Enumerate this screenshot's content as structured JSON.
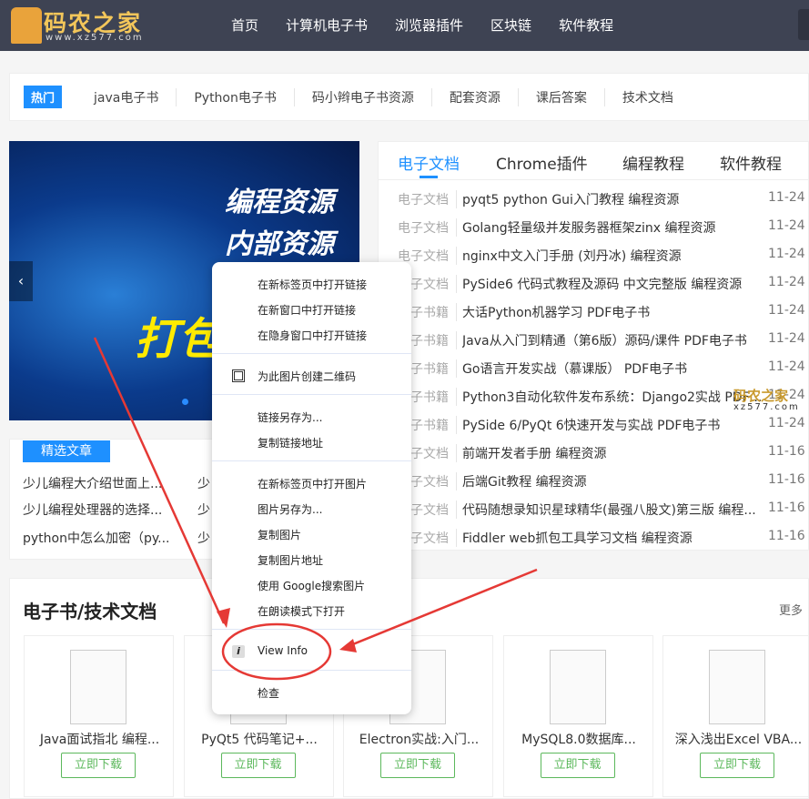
{
  "header": {
    "logo_text": "码农之家",
    "logo_url": "www.xz577.com",
    "nav": [
      "首页",
      "计算机电子书",
      "浏览器插件",
      "区块链",
      "软件教程"
    ]
  },
  "hot": {
    "tag": "热门",
    "links": [
      "java电子书",
      "Python电子书",
      "码小辫电子书资源",
      "配套资源",
      "课后答案",
      "技术文档"
    ]
  },
  "banner": {
    "line1": "编程资源",
    "line2": "内部资源",
    "line3": "打包",
    "prev_icon": "chevron-left-icon"
  },
  "featured": {
    "tag": "精选文章",
    "articles": [
      "少儿编程大介绍世面上...",
      "少儿编程处理器的选择...",
      "python中怎么加密（py...",
      "少",
      "少",
      "少"
    ]
  },
  "tabs": {
    "items": [
      "电子文档",
      "Chrome插件",
      "编程教程",
      "软件教程"
    ],
    "active": 0,
    "rows": [
      {
        "cat": "电子文档",
        "title": "pyqt5 python Gui入门教程 编程资源",
        "date": "11-24"
      },
      {
        "cat": "电子文档",
        "title": "Golang轻量级并发服务器框架zinx 编程资源",
        "date": "11-24"
      },
      {
        "cat": "电子文档",
        "title": "nginx中文入门手册 (刘丹冰) 编程资源",
        "date": "11-24"
      },
      {
        "cat": "电子文档",
        "title": "PySide6 代码式教程及源码 中文完整版 编程资源",
        "date": "11-24"
      },
      {
        "cat": "电子书籍",
        "title": "大话Python机器学习 PDF电子书",
        "date": "11-24"
      },
      {
        "cat": "电子书籍",
        "title": "Java从入门到精通（第6版）源码/课件 PDF电子书",
        "date": "11-24"
      },
      {
        "cat": "电子书籍",
        "title": "Go语言开发实战（慕课版） PDF电子书",
        "date": "11-24"
      },
      {
        "cat": "电子书籍",
        "title": "Python3自动化软件发布系统：Django2实战 PDF电子书",
        "date": "11-24"
      },
      {
        "cat": "电子书籍",
        "title": "PySide 6/PyQt 6快速开发与实战 PDF电子书",
        "date": "11-24"
      },
      {
        "cat": "电子文档",
        "title": "前端开发者手册 编程资源",
        "date": "11-16"
      },
      {
        "cat": "电子文档",
        "title": "后端Git教程 编程资源",
        "date": "11-16"
      },
      {
        "cat": "电子文档",
        "title": "代码随想录知识星球精华(最强八股文)第三版 编程...",
        "date": "11-16"
      },
      {
        "cat": "电子文档",
        "title": "Fiddler web抓包工具学习文档 编程资源",
        "date": "11-16"
      }
    ]
  },
  "watermark": {
    "text": "码农之家",
    "url": "xz577.com"
  },
  "books": {
    "title": "电子书/技术文档",
    "more": "更多",
    "download_label": "立即下载",
    "items": [
      "Java面试指北 编程...",
      "PyQt5 代码笔记+...",
      "Electron实战:入门...",
      "MySQL8.0数据库...",
      "深入浅出Excel VBA..."
    ]
  },
  "context_menu": {
    "groups": [
      [
        "在新标签页中打开链接",
        "在新窗口中打开链接",
        "在隐身窗口中打开链接"
      ],
      [
        "为此图片创建二维码"
      ],
      [
        "链接另存为...",
        "复制链接地址"
      ],
      [
        "在新标签页中打开图片",
        "图片另存为...",
        "复制图片",
        "复制图片地址",
        "使用 Google搜索图片",
        "在朗读模式下打开"
      ],
      [
        "View Info"
      ],
      [
        "检查"
      ]
    ]
  },
  "annotation_color": "#e53935"
}
